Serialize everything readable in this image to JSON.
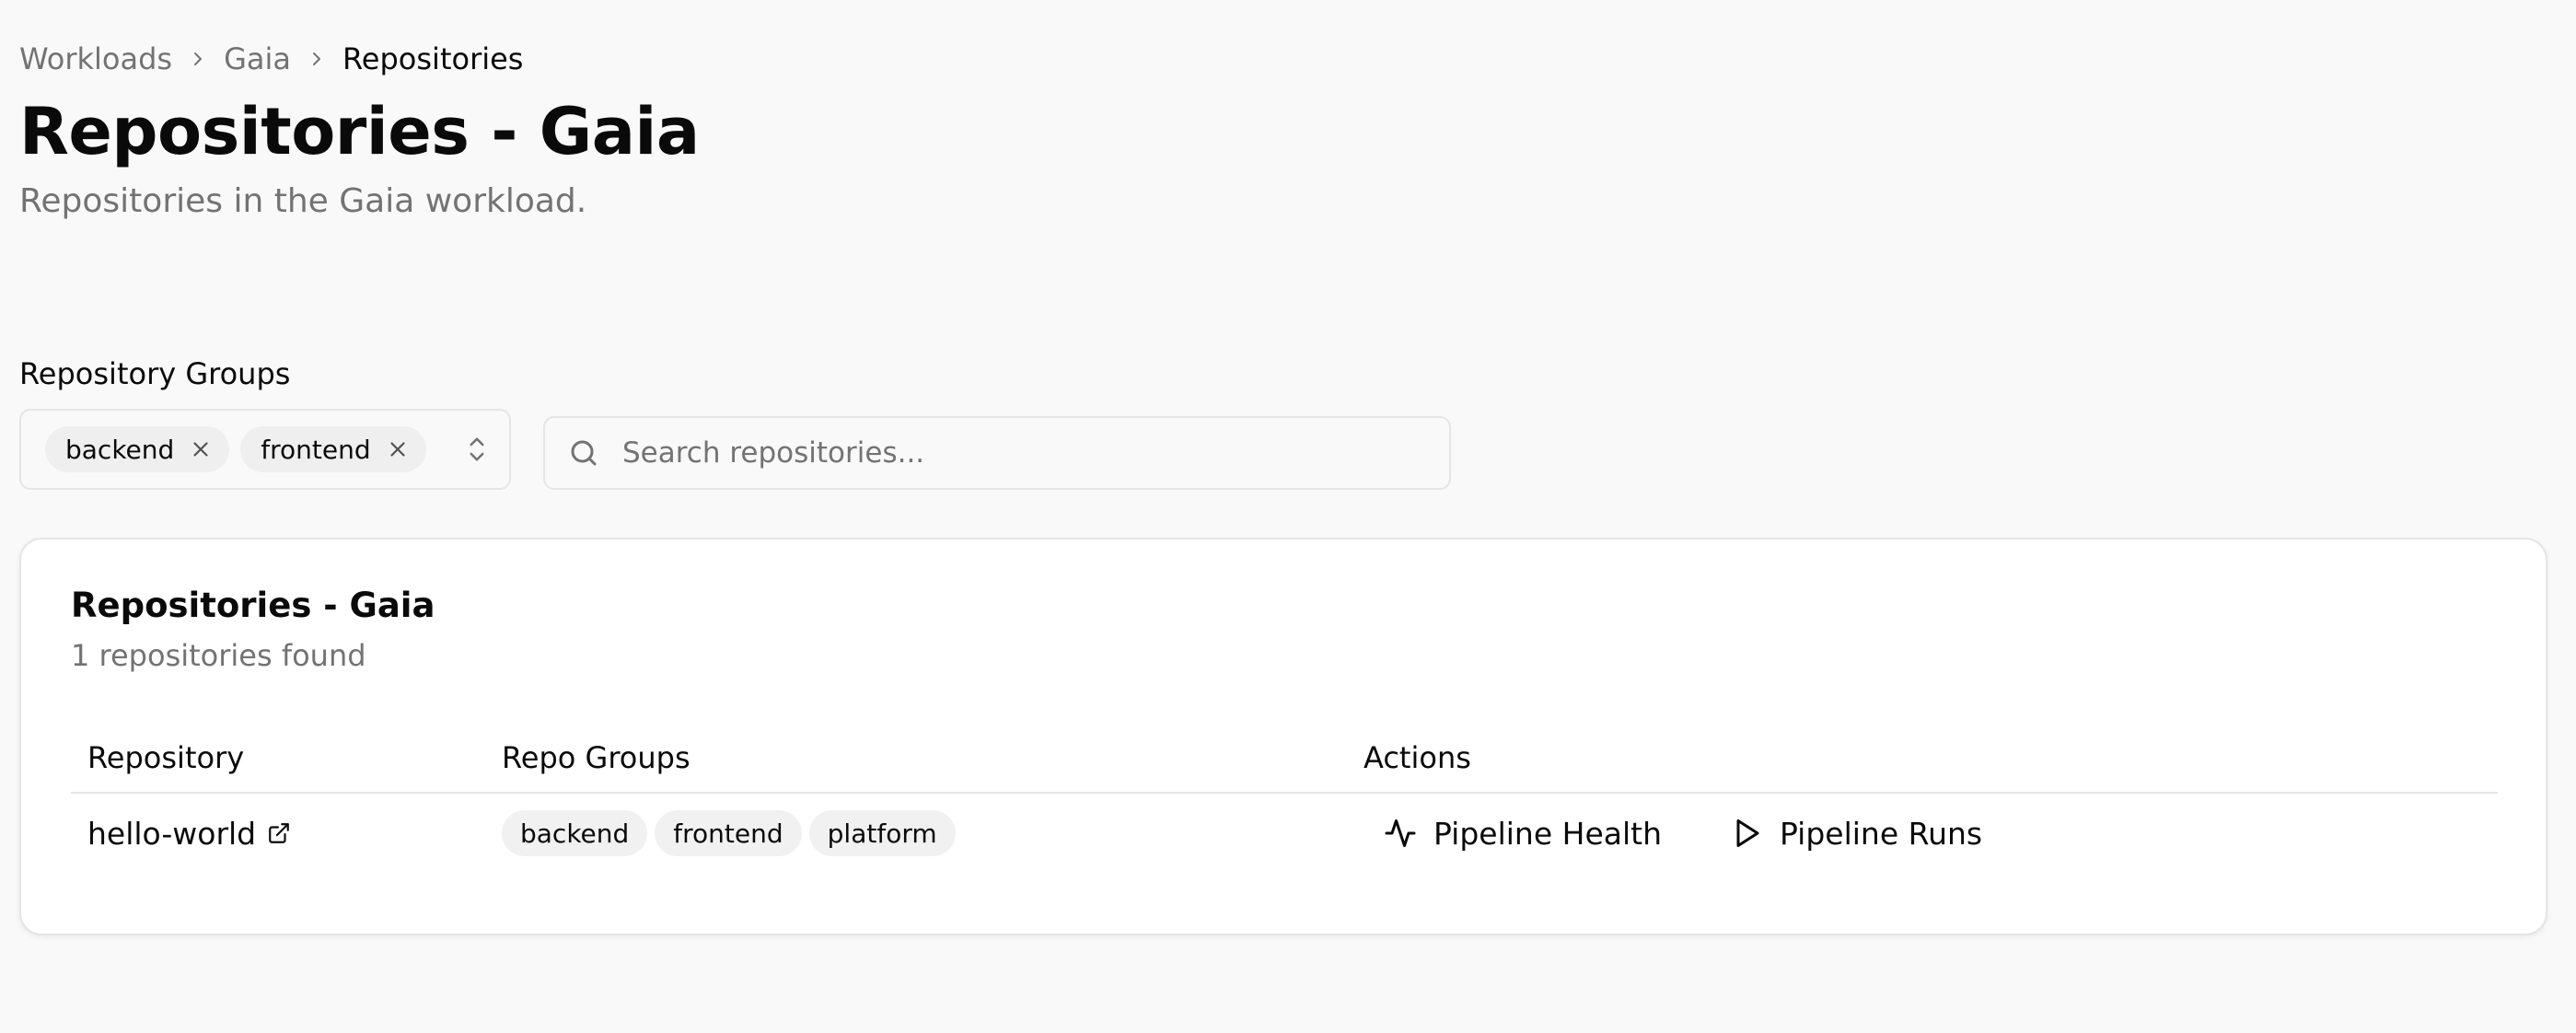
{
  "breadcrumb": {
    "items": [
      "Workloads",
      "Gaia",
      "Repositories"
    ]
  },
  "header": {
    "title": "Repositories - Gaia",
    "subtitle": "Repositories in the Gaia workload."
  },
  "filters": {
    "groups_label": "Repository Groups",
    "selected_groups": [
      "backend",
      "frontend"
    ],
    "search_placeholder": "Search repositories..."
  },
  "card": {
    "title": "Repositories - Gaia",
    "description": "1 repositories found"
  },
  "table": {
    "columns": [
      "Repository",
      "Repo Groups",
      "Actions"
    ],
    "rows": [
      {
        "repository": "hello-world",
        "groups": [
          "backend",
          "frontend",
          "platform"
        ],
        "actions": [
          "Pipeline Health",
          "Pipeline Runs"
        ]
      }
    ]
  },
  "icons": {
    "chevron": "chevron-right-icon",
    "chip_remove": "x-icon",
    "select": "chevrons-up-down-icon",
    "search": "search-icon",
    "external_link": "external-link-icon",
    "pipeline_health": "activity-icon",
    "pipeline_runs": "play-icon"
  }
}
